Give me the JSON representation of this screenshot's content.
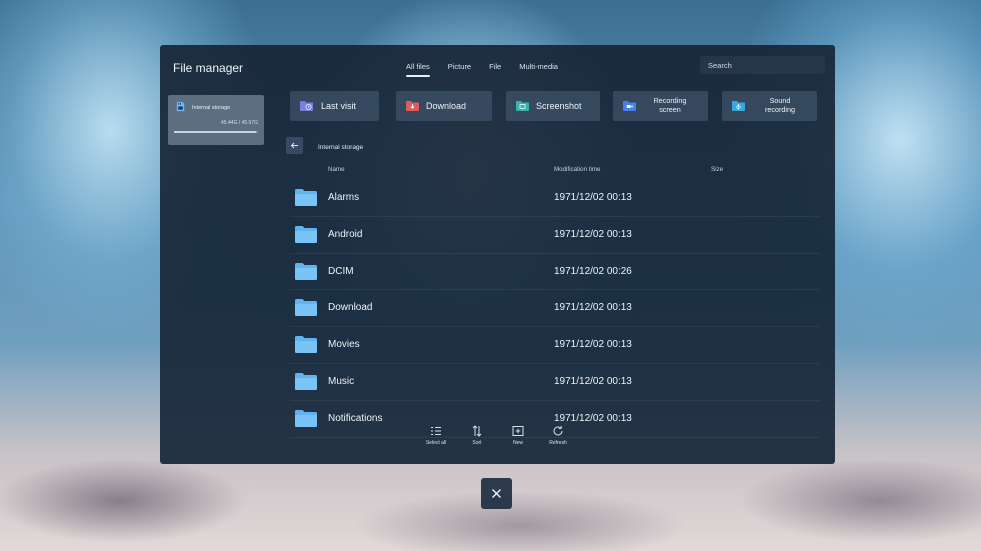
{
  "window": {
    "title": "File manager",
    "tabs": [
      {
        "label": "All files",
        "active": true
      },
      {
        "label": "Picture",
        "active": false
      },
      {
        "label": "File",
        "active": false
      },
      {
        "label": "Multi-media",
        "active": false
      }
    ],
    "search_placeholder": "Search"
  },
  "sidebar": {
    "storage": {
      "name": "Internal storage",
      "size": "45.44G / 45.97G",
      "used_fraction": 0.98
    }
  },
  "quick_access": [
    {
      "label": "Last visit",
      "icon": "folder-clock-icon",
      "color": "#7a7ee0"
    },
    {
      "label": "Download",
      "icon": "download-icon",
      "color": "#e05a5a"
    },
    {
      "label": "Screenshot",
      "icon": "screenshot-icon",
      "color": "#37b3a8"
    },
    {
      "label_line1": "Recording",
      "label_line2": "screen",
      "icon": "screen-record-icon",
      "color": "#4a7fe8"
    },
    {
      "label_line1": "Sound",
      "label_line2": "recording",
      "icon": "sound-record-icon",
      "color": "#38a8e0"
    }
  ],
  "breadcrumb": {
    "path": "Internal storage"
  },
  "columns": {
    "name": "Name",
    "modified": "Modification time",
    "size": "Size"
  },
  "files": [
    {
      "name": "Alarms",
      "modified": "1971/12/02 00:13"
    },
    {
      "name": "Android",
      "modified": "1971/12/02 00:13"
    },
    {
      "name": "DCIM",
      "modified": "1971/12/02 00:26"
    },
    {
      "name": "Download",
      "modified": "1971/12/02 00:13"
    },
    {
      "name": "Movies",
      "modified": "1971/12/02 00:13"
    },
    {
      "name": "Music",
      "modified": "1971/12/02 00:13"
    },
    {
      "name": "Notifications",
      "modified": "1971/12/02 00:13"
    }
  ],
  "toolbar": {
    "select_all": "Select all",
    "sort": "Sort",
    "new": "New",
    "refresh": "Refresh"
  },
  "colors": {
    "folder": "#5fb4f0",
    "accent": "#e8eef4"
  },
  "close_icon": "close-icon"
}
